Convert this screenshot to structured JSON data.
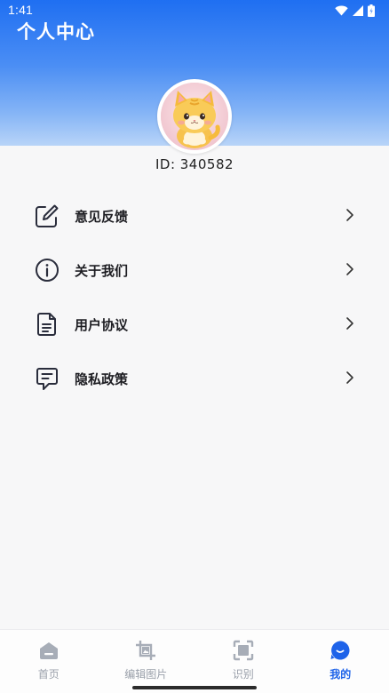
{
  "status_bar": {
    "time": "1:41"
  },
  "header": {
    "title": "个人中心"
  },
  "profile": {
    "avatar": "cat-avatar",
    "user_id": "ID: 340582"
  },
  "menu": {
    "items": [
      {
        "label": "意见反馈",
        "icon": "edit-icon"
      },
      {
        "label": "关于我们",
        "icon": "info-icon"
      },
      {
        "label": "用户协议",
        "icon": "document-icon"
      },
      {
        "label": "隐私政策",
        "icon": "message-icon"
      }
    ]
  },
  "tabbar": {
    "items": [
      {
        "label": "首页",
        "icon": "home-icon",
        "active": false
      },
      {
        "label": "编辑图片",
        "icon": "crop-image-icon",
        "active": false
      },
      {
        "label": "识别",
        "icon": "scan-icon",
        "active": false
      },
      {
        "label": "我的",
        "icon": "profile-icon",
        "active": true
      }
    ]
  },
  "colors": {
    "accent": "#1e63e9",
    "header_top": "#1f6ff2",
    "header_bottom": "#b8d4f8",
    "inactive_tab": "#9aa0aa"
  }
}
